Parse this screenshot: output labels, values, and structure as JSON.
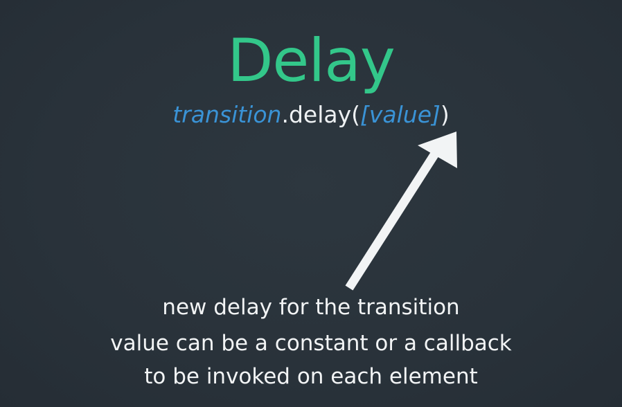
{
  "slide": {
    "title": "Delay",
    "signature": {
      "object": "transition",
      "method": ".delay(",
      "param": "[value]",
      "close": ")"
    },
    "captions": [
      "new delay for the transition",
      "value can be a constant or a callback",
      "to be invoked on each element"
    ]
  },
  "colors": {
    "background": "#2b343c",
    "title": "#33c78a",
    "accent": "#3a93d6",
    "text": "#eef1f3",
    "arrow": "#f2f4f5"
  },
  "icons": {
    "arrow": "arrow-up-right-icon"
  }
}
